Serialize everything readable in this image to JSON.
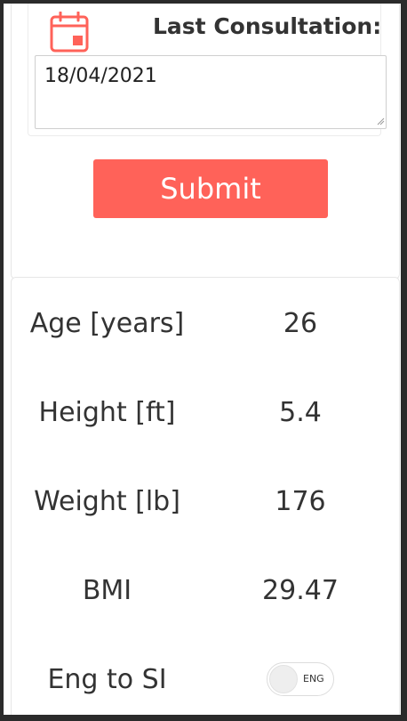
{
  "consultation": {
    "label": "Last Consultation:",
    "date_value": "18/04/2021"
  },
  "form": {
    "submit_label": "Submit"
  },
  "stats": [
    {
      "label": "Age [years]",
      "value": "26"
    },
    {
      "label": "Height [ft]",
      "value": "5.4"
    },
    {
      "label": "Weight [lb]",
      "value": "176"
    },
    {
      "label": "BMI",
      "value": "29.47"
    }
  ],
  "unit_toggle": {
    "label": "Eng to SI",
    "state_text": "ENG"
  },
  "colors": {
    "accent": "#ff6259",
    "text": "#333333"
  },
  "icons": {
    "calendar": "calendar-icon"
  }
}
